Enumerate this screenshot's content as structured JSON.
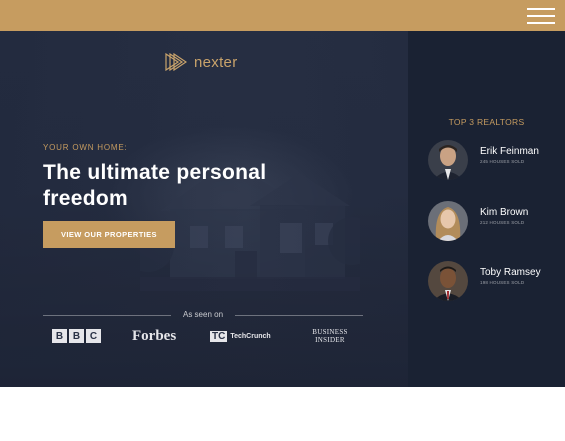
{
  "header": {
    "menu_icon": "hamburger-menu-icon",
    "bar_color": "#c69c60"
  },
  "brand": {
    "logo_text": "nexter",
    "logo_icon": "triangle-play-logo-icon",
    "accent": "#c69c60"
  },
  "hero": {
    "eyebrow": "YOUR OWN HOME:",
    "headline": "The ultimate personal freedom",
    "cta_label": "VIEW OUR PROPERTIES",
    "as_seen_on": "As seen on",
    "press": {
      "bbc_letters": [
        "B",
        "B",
        "C"
      ],
      "forbes": "Forbes",
      "techcrunch_mark": "TC",
      "techcrunch": "TechCrunch",
      "business_insider_line1": "BUSINESS",
      "business_insider_line2": "INSIDER"
    }
  },
  "sidebar": {
    "title": "TOP 3 REALTORS",
    "realtors": [
      {
        "name": "Erik Feinman",
        "houses_sold": "245 HOUSES SOLD"
      },
      {
        "name": "Kim Brown",
        "houses_sold": "212 HOUSES SOLD"
      },
      {
        "name": "Toby Ramsey",
        "houses_sold": "198 HOUSES SOLD"
      }
    ],
    "background": "#1a2233"
  }
}
